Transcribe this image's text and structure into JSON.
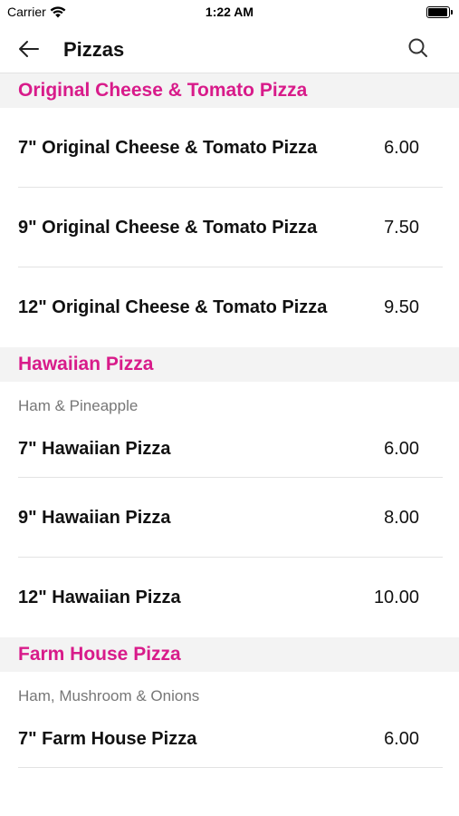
{
  "status": {
    "carrier": "Carrier",
    "time": "1:22 AM"
  },
  "nav": {
    "title": "Pizzas"
  },
  "sections": [
    {
      "title": "Original Cheese & Tomato Pizza",
      "items": [
        {
          "name": "7\" Original Cheese & Tomato Pizza",
          "price": "6.00"
        },
        {
          "name": "9\" Original Cheese & Tomato Pizza",
          "price": "7.50"
        },
        {
          "name": "12\" Original Cheese & Tomato Pizza",
          "price": "9.50"
        }
      ]
    },
    {
      "title": "Hawaiian Pizza",
      "description": "Ham & Pineapple",
      "items": [
        {
          "name": "7\" Hawaiian Pizza",
          "price": "6.00"
        },
        {
          "name": "9\" Hawaiian Pizza",
          "price": "8.00"
        },
        {
          "name": "12\" Hawaiian Pizza",
          "price": "10.00"
        }
      ]
    },
    {
      "title": "Farm House Pizza",
      "description": "Ham, Mushroom & Onions",
      "items": [
        {
          "name": "7\" Farm House Pizza",
          "price": "6.00"
        }
      ]
    }
  ],
  "colors": {
    "accent": "#d81b8a",
    "section_bg": "#f3f3f3",
    "divider": "#e3e3e3"
  },
  "icons": {
    "back": "arrow-left-icon",
    "search": "search-icon",
    "wifi": "wifi-icon",
    "battery": "battery-icon"
  }
}
